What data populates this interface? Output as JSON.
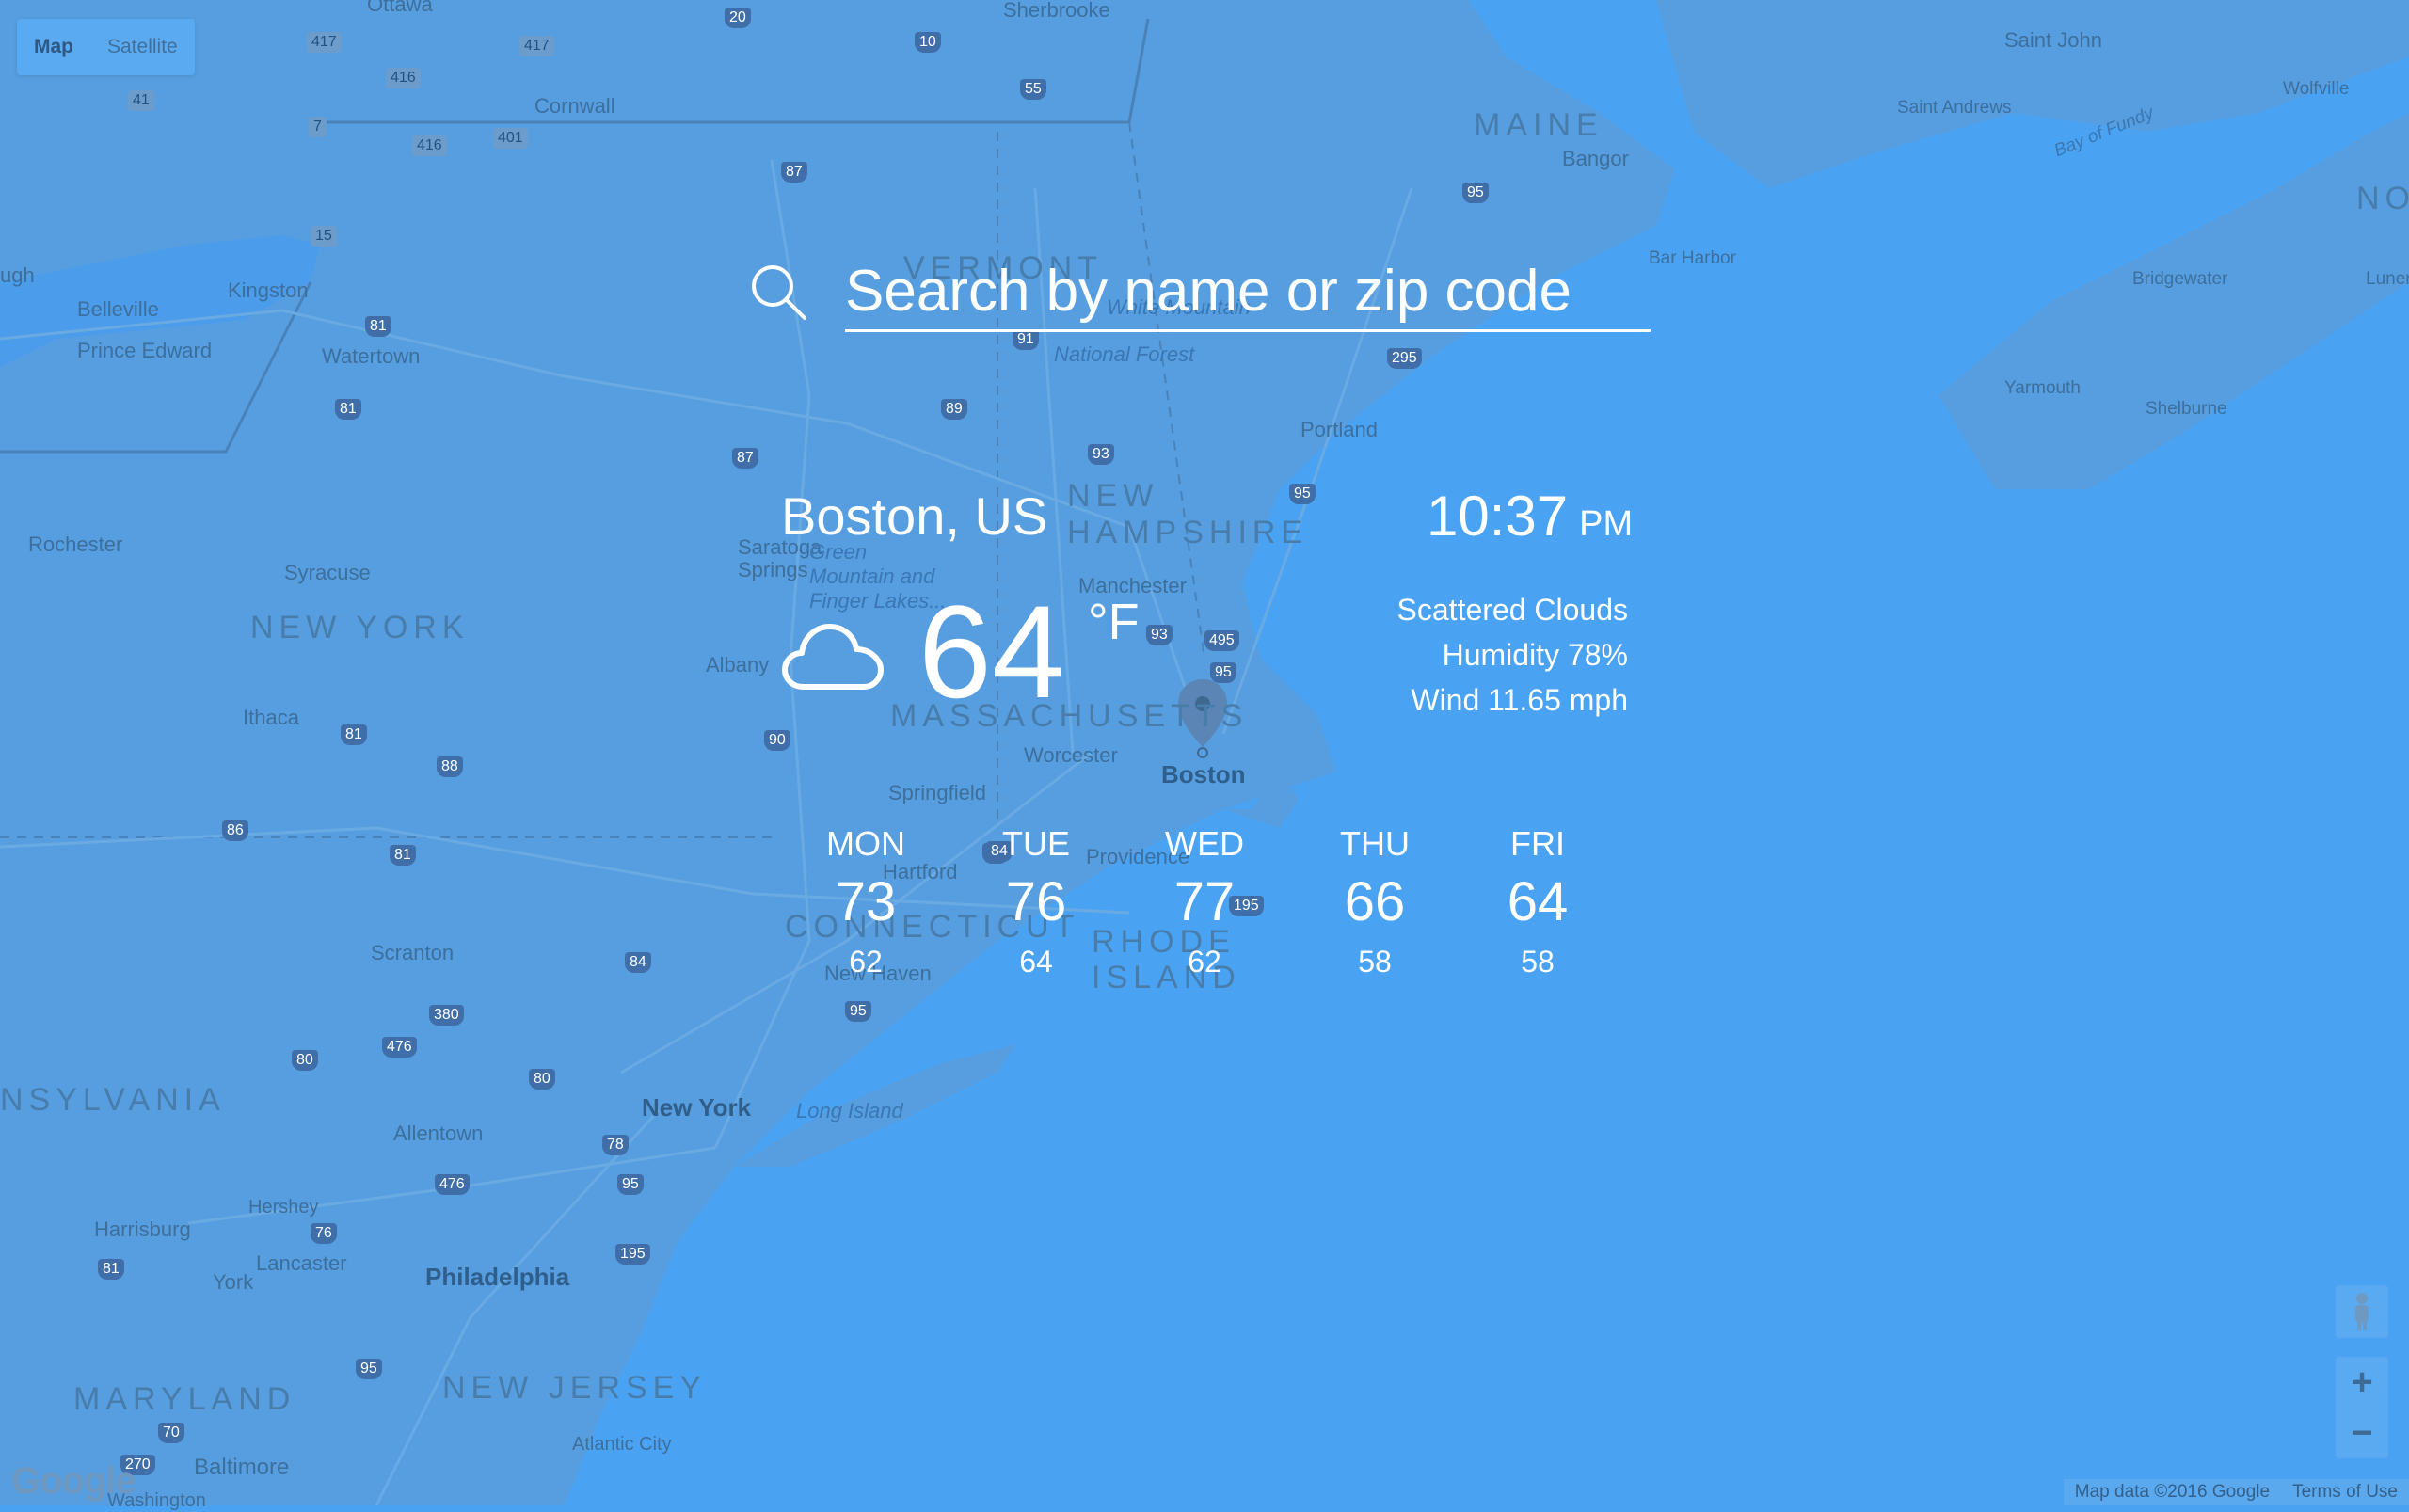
{
  "map": {
    "type_control": [
      "Map",
      "Satellite"
    ],
    "labels": {
      "ottawa": "Ottawa",
      "sherbrooke": "Sherbrooke",
      "saint_john": "Saint John",
      "saint_andrews": "Saint Andrews",
      "wolfville": "Wolfville",
      "maine": "MAINE",
      "bangor": "Bangor",
      "bay_of_fundy": "Bay of Fundy",
      "cornwall": "Cornwall",
      "kingston": "Kingston",
      "belleville": "Belleville",
      "prince_edward": "Prince Edward",
      "watertown": "Watertown",
      "ugh": "ugh",
      "bar_harbor": "Bar Harbor",
      "bridgewater": "Bridgewater",
      "lunen": "Lunen",
      "no": "NO",
      "yarmouth": "Yarmouth",
      "shelburne": "Shelburne",
      "vermont": "VERMONT",
      "white_mountain": "White Mountain",
      "national_forest": "National Forest",
      "portland": "Portland",
      "new_hampshire": "NEW HAMPSHIRE",
      "rochester": "Rochester",
      "syracuse": "Syracuse",
      "saratoga": "Saratoga Springs",
      "green_mountain": "Green Mountain and Finger Lakes...",
      "manchester": "Manchester",
      "new_york_state": "NEW YORK",
      "albany": "Albany",
      "ithaca": "Ithaca",
      "massachusetts": "MASSACHUSETTS",
      "worcester": "Worcester",
      "boston": "Boston",
      "springfield": "Springfield",
      "hartford": "Hartford",
      "providence": "Providence",
      "connecticut": "CONNECTICUT",
      "rhode_island": "RHODE ISLAND",
      "new_haven": "New Haven",
      "scranton": "Scranton",
      "pennsylvania": "NSYLVANIA",
      "new_york": "New York",
      "long_island": "Long Island",
      "allentown": "Allentown",
      "hershey": "Hershey",
      "harrisburg": "Harrisburg",
      "lancaster": "Lancaster",
      "york": "York",
      "philadelphia": "Philadelphia",
      "maryland": "MARYLAND",
      "new_jersey": "NEW JERSEY",
      "baltimore": "Baltimore",
      "atlantic_city": "Atlantic City",
      "washington": "Washington"
    },
    "shields": [
      "417",
      "416",
      "417",
      "20",
      "10",
      "41",
      "7",
      "416",
      "401",
      "55",
      "87",
      "15",
      "81",
      "91",
      "89",
      "87",
      "93",
      "95",
      "295",
      "81",
      "95",
      "95",
      "93",
      "495",
      "90",
      "81",
      "88",
      "86",
      "81",
      "90",
      "84",
      "95",
      "195",
      "84",
      "380",
      "476",
      "80",
      "80",
      "78",
      "95",
      "476",
      "81",
      "76",
      "195",
      "95",
      "270",
      "70"
    ],
    "zoom_in": "+",
    "zoom_out": "−",
    "logo": "Google",
    "attribution": [
      "Map data ©2016 Google",
      "Terms of Use"
    ]
  },
  "search": {
    "placeholder": "Search by name or zip code"
  },
  "weather": {
    "city": "Boston, US",
    "time": "10:37",
    "ampm": "PM",
    "temperature": "64",
    "unit": "°F",
    "condition": "Scattered Clouds",
    "humidity": "Humidity 78%",
    "wind": "Wind 11.65 mph",
    "icon": "cloud-icon"
  },
  "forecast": [
    {
      "day": "MON",
      "high": "73",
      "low": "62"
    },
    {
      "day": "TUE",
      "high": "76",
      "low": "64"
    },
    {
      "day": "WED",
      "high": "77",
      "low": "62"
    },
    {
      "day": "THU",
      "high": "66",
      "low": "58"
    },
    {
      "day": "FRI",
      "high": "64",
      "low": "58"
    }
  ],
  "colors": {
    "overlay": "#4aa3f2",
    "land": "#569ee0",
    "water": "#4aa3f2",
    "text": "#ffffff"
  }
}
